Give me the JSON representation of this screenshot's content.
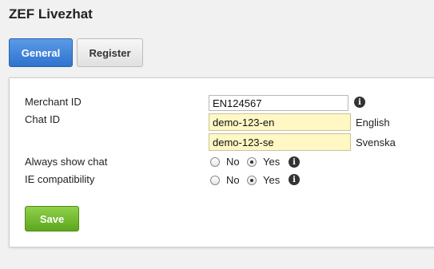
{
  "page": {
    "title": "ZEF Livezhat"
  },
  "tabs": [
    {
      "label": "General",
      "active": true
    },
    {
      "label": "Register",
      "active": false
    }
  ],
  "form": {
    "merchant_id": {
      "label": "Merchant ID",
      "value": "EN124567"
    },
    "chat_id": {
      "label": "Chat ID",
      "entries": [
        {
          "value": "demo-123-en",
          "language": "English"
        },
        {
          "value": "demo-123-se",
          "language": "Svenska"
        }
      ]
    },
    "always_show_chat": {
      "label": "Always show chat",
      "no_label": "No",
      "yes_label": "Yes",
      "selected": "Yes"
    },
    "ie_compatibility": {
      "label": "IE compatibility",
      "no_label": "No",
      "yes_label": "Yes",
      "selected": "Yes"
    },
    "info_icon_glyph": "i"
  },
  "actions": {
    "save_label": "Save"
  },
  "colors": {
    "active_tab": "#2f73cf",
    "save_button": "#5ea61f",
    "highlight_input": "#fff8c4"
  }
}
